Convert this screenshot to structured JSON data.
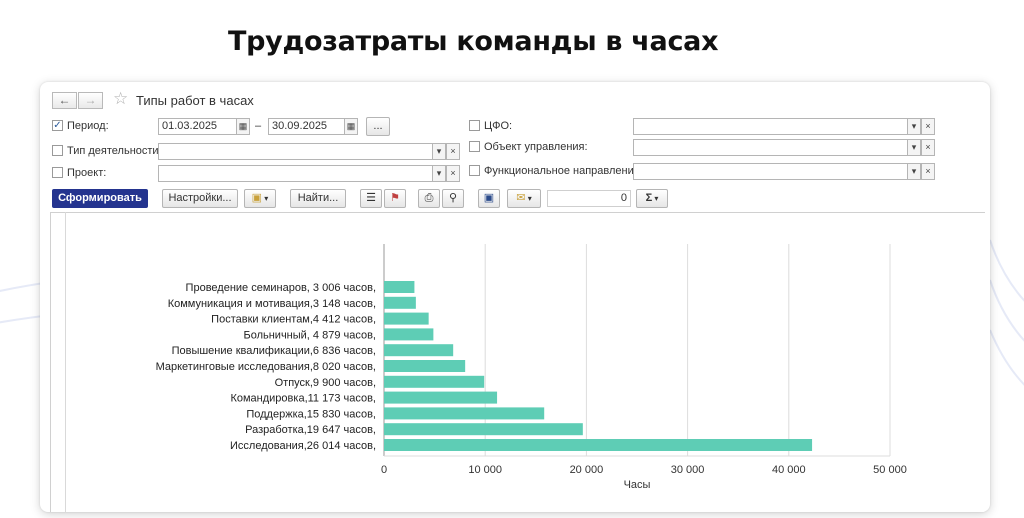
{
  "slide": {
    "title": "Трудозатраты команды в часах"
  },
  "form": {
    "title": "Типы работ в часах",
    "period": {
      "label": "Период:",
      "checked": true,
      "from": "01.03.2025",
      "dash": "–",
      "to": "30.09.2025",
      "choose": "..."
    },
    "activity_type": {
      "label": "Тип деятельности:",
      "value": ""
    },
    "project": {
      "label": "Проект:",
      "value": ""
    },
    "cfo": {
      "label": "ЦФО:",
      "value": ""
    },
    "control_object": {
      "label": "Объект управления:",
      "value": ""
    },
    "functional_direction": {
      "label": "Функциональное направление:",
      "value": ""
    }
  },
  "toolbar": {
    "generate": "Сформировать",
    "settings": "Настройки...",
    "find": "Найти...",
    "sum_value": "0",
    "sigma": "Σ"
  },
  "chart_data": {
    "type": "bar",
    "orientation": "horizontal",
    "categories": [
      "Проведение семинаров, 3 006 часов,",
      "Коммуникация и мотивация,3 148 часов,",
      "Поставки клиентам,4 412 часов,",
      "Больничный, 4 879 часов,",
      "Повышение квалификации,6 836 часов,",
      "Маркетинговые исследования,8 020 часов,",
      "Отпуск,9 900 часов,",
      "Командировка,11 173 часов,",
      "Поддержка,15 830 часов,",
      "Разработка,19 647 часов,",
      "Исследования,26 014 часов,"
    ],
    "values": [
      3006,
      3148,
      4412,
      4879,
      6836,
      8020,
      9900,
      11173,
      15830,
      19647,
      42300
    ],
    "xlabel": "Часы",
    "xlim": [
      0,
      50000
    ],
    "xticks": [
      0,
      10000,
      20000,
      30000,
      40000,
      50000
    ],
    "xtick_labels": [
      "0",
      "10 000",
      "20 000",
      "30 000",
      "40 000",
      "50 000"
    ],
    "grid": true,
    "color": "#5ecdb5"
  }
}
